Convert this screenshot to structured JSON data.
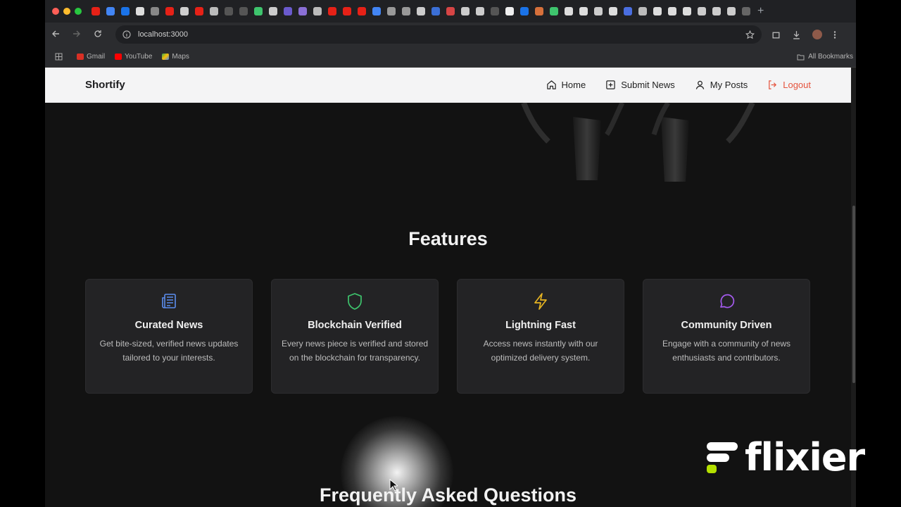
{
  "browser": {
    "url": "localhost:3000",
    "bookmarks": [
      {
        "label": "Gmail",
        "icon": "gmail-icon"
      },
      {
        "label": "YouTube",
        "icon": "youtube-icon"
      },
      {
        "label": "Maps",
        "icon": "maps-icon"
      }
    ],
    "all_bookmarks_label": "All Bookmarks",
    "new_tab_glyph": "+"
  },
  "navbar": {
    "brand": "Shortify",
    "links": [
      {
        "label": "Home",
        "icon": "home-icon"
      },
      {
        "label": "Submit News",
        "icon": "plus-square-icon"
      },
      {
        "label": "My Posts",
        "icon": "user-icon"
      },
      {
        "label": "Logout",
        "icon": "logout-icon"
      }
    ]
  },
  "features": {
    "title": "Features",
    "cards": [
      {
        "title": "Curated News",
        "desc": "Get bite-sized, verified news updates tailored to your interests.",
        "icon": "newspaper-icon",
        "color": "#5b8def"
      },
      {
        "title": "Blockchain Verified",
        "desc": "Every news piece is verified and stored on the blockchain for transparency.",
        "icon": "shield-icon",
        "color": "#3ec46d"
      },
      {
        "title": "Lightning Fast",
        "desc": "Access news instantly with our optimized delivery system.",
        "icon": "lightning-icon",
        "color": "#e6b422"
      },
      {
        "title": "Community Driven",
        "desc": "Engage with a community of news enthusiasts and contributors.",
        "icon": "chat-bubble-icon",
        "color": "#a55bef"
      }
    ]
  },
  "faq": {
    "title": "Frequently Asked Questions"
  },
  "watermark": {
    "text": "flixier"
  },
  "colors": {
    "logout": "#e5533d",
    "page_background": "#121212",
    "card_background": "#232325",
    "navbar_background": "#f4f4f5"
  }
}
